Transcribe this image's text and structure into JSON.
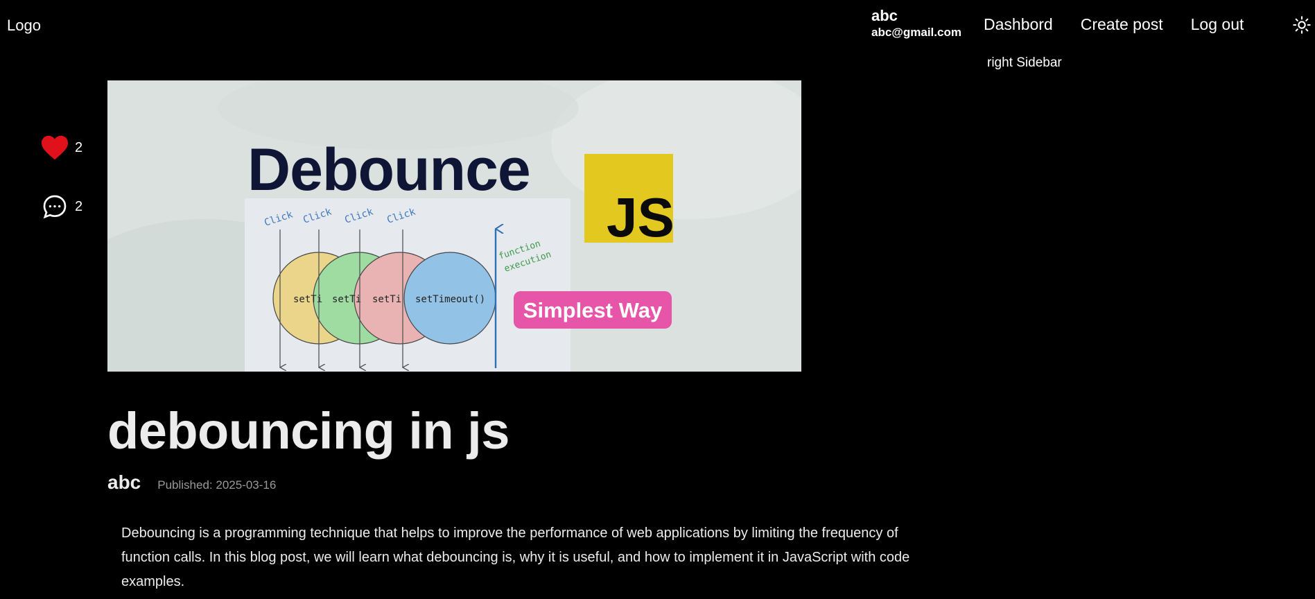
{
  "header": {
    "logo": "Logo",
    "user": {
      "name": "abc",
      "email": "abc@gmail.com"
    },
    "nav": [
      {
        "label": "Dashbord"
      },
      {
        "label": "Create post"
      },
      {
        "label": "Log out"
      }
    ],
    "theme_icon": "sun-icon"
  },
  "sidebar": {
    "label": "right Sidebar"
  },
  "reactions": {
    "likes": {
      "icon": "heart-icon",
      "count": "2",
      "color": "#e0111b"
    },
    "comments": {
      "icon": "comment-icon",
      "count": "2"
    }
  },
  "hero": {
    "title": "Debounce",
    "badge": "JS",
    "badge_color": "#e2c81f",
    "pill": "Simplest Way",
    "pill_color": "#e655a8",
    "click_label": "Click",
    "timeout_label": "setTimeout()",
    "timeout_short": [
      "setTi",
      "setTi",
      "setTi"
    ],
    "execution_label": [
      "function",
      "execution"
    ],
    "circle_colors": [
      "#ead58a",
      "#9fdca2",
      "#e9b3b3",
      "#93c2e7"
    ]
  },
  "post": {
    "title": "debouncing in js",
    "author": "abc",
    "published": "Published: 2025-03-16",
    "body": "Debouncing is a programming technique that helps to improve the performance of web applications by limiting the frequency of function calls. In this blog post, we will learn what debouncing is, why it is useful, and how to implement it in JavaScript with code examples."
  }
}
